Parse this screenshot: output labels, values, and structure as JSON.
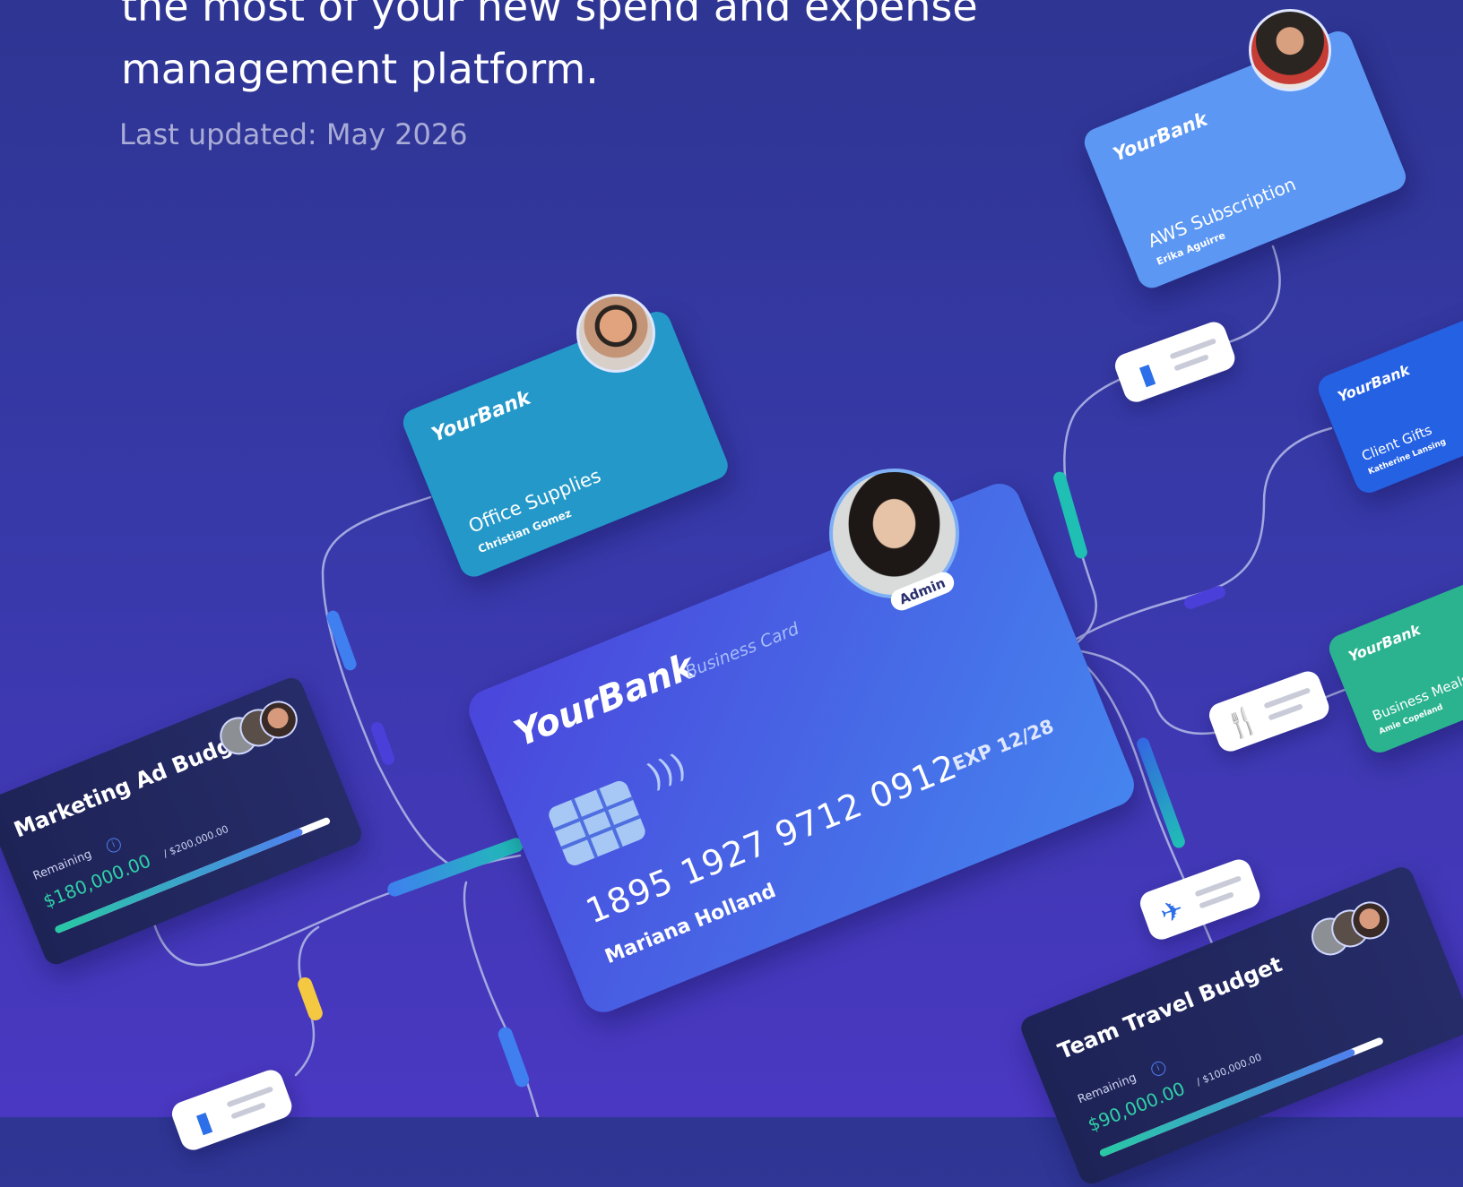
{
  "headline": {
    "line1": "the most of your new spend and expense",
    "line2": "management platform."
  },
  "last_updated": "Last updated: May 2026",
  "main_card": {
    "brand": "YourBank",
    "label": "Business Card",
    "number": "1895 1927 9712 0912",
    "expiry": "EXP 12/28",
    "holder": "Mariana Holland",
    "badge": "Admin",
    "color_start": "#4a45db",
    "color_end": "#4585ef",
    "chip_icon": "chip-icon",
    "contactless_icon": "contactless-icon"
  },
  "cards": [
    {
      "brand": "YourBank",
      "title": "Office Supplies",
      "owner": "Christian Gomez",
      "color": "#2398c9"
    },
    {
      "brand": "YourBank",
      "title": "AWS Subscription",
      "owner": "Erika Aguirre",
      "color": "#5b97f3"
    },
    {
      "brand": "YourBank",
      "title": "Client Gifts",
      "owner": "Katherine Lansing",
      "color": "#2561e3"
    },
    {
      "brand": "YourBank",
      "title": "Business Meals",
      "owner": "Amie Copeland",
      "color": "#2bb38f"
    }
  ],
  "budgets": [
    {
      "title": "Marketing Ad Budget",
      "remaining_label": "Remaining",
      "amount": "$180,000.00",
      "total": "/ $200,000.00",
      "progress": 0.9
    },
    {
      "title": "Team Travel Budget",
      "remaining_label": "Remaining",
      "amount": "$90,000.00",
      "total": "/ $100,000.00",
      "progress": 0.9
    }
  ],
  "receipts": [
    {
      "icon": "receipt-icon"
    },
    {
      "icon": "fork-knife-icon"
    },
    {
      "icon": "airplane-icon"
    },
    {
      "icon": "receipt-icon"
    }
  ],
  "colors": {
    "background": "#3739a8",
    "connector": "#9fa4dc",
    "teal_pill": "#1fbfb4",
    "blue_pill": "#3f7ff0",
    "yellow_pill": "#f5c842",
    "budget_bg": "#1e2356"
  }
}
